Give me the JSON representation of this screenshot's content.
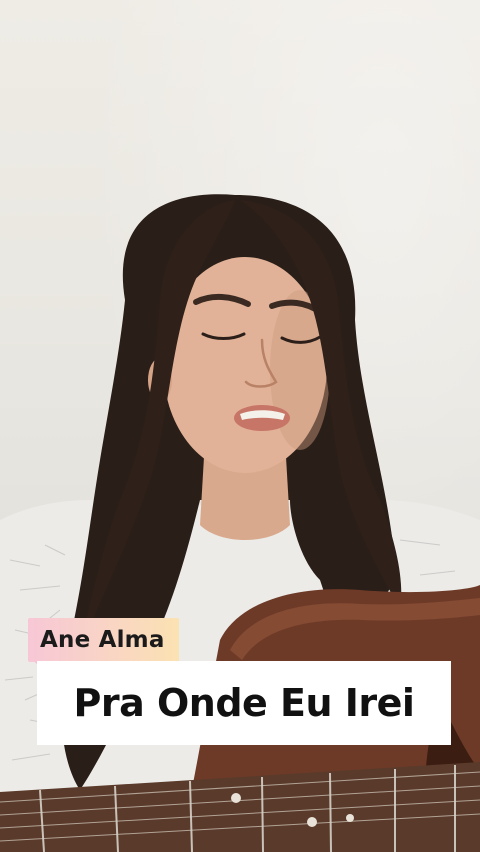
{
  "overlay": {
    "artist": "Ane Alma",
    "song_title": "Pra Onde Eu Irei"
  },
  "colors": {
    "artist_tag_gradient": [
      "#f7c7d6",
      "#fbe2b2"
    ],
    "song_box": "#ffffff",
    "text": "#111111"
  }
}
